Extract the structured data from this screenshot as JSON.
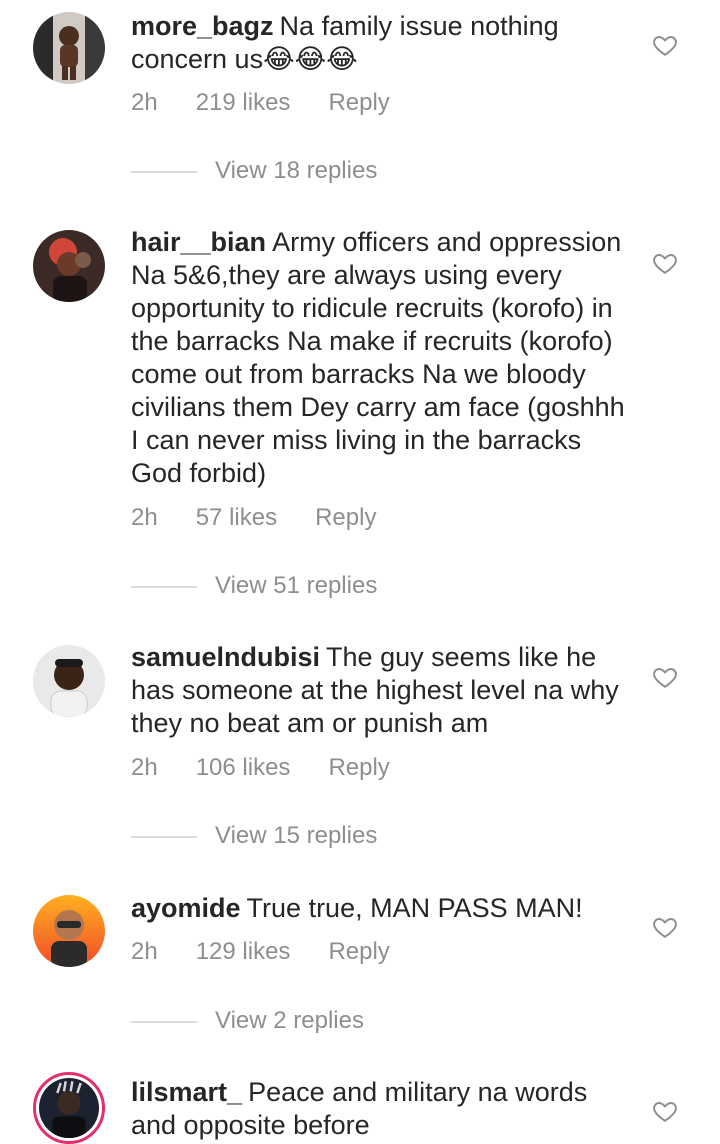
{
  "comments": [
    {
      "username": "more_bagz",
      "text": "Na family issue nothing concern us😂😂😂",
      "time": "2h",
      "likes": "219 likes",
      "reply": "Reply",
      "view_replies": "View 18 replies"
    },
    {
      "username": "hair__bian",
      "text": "Army officers and oppression Na 5&6,they are always using every opportunity to ridicule recruits (korofo) in the barracks Na make if recruits (korofo) come out from barracks Na we bloody civilians them Dey carry am face (goshhh I can never miss living in the barracks God forbid)",
      "time": "2h",
      "likes": "57 likes",
      "reply": "Reply",
      "view_replies": "View 51 replies"
    },
    {
      "username": "samuelndubisi",
      "text": "The guy seems like he has someone at the highest level na why they no beat am or punish am",
      "time": "2h",
      "likes": "106 likes",
      "reply": "Reply",
      "view_replies": "View 15 replies"
    },
    {
      "username": "ayomide",
      "text": "True true, MAN PASS MAN!",
      "time": "2h",
      "likes": "129 likes",
      "reply": "Reply",
      "view_replies": "View 2 replies"
    },
    {
      "username": "lilsmart_",
      "text": "Peace and military na words and opposite before",
      "time": "",
      "likes": "",
      "reply": "",
      "view_replies": ""
    }
  ],
  "icons": {
    "heart": "heart-outline-icon"
  },
  "colors": {
    "text": "#262626",
    "muted": "#8e8e8e",
    "divider": "#dbdbdb",
    "story_ring": "#e1306c"
  }
}
